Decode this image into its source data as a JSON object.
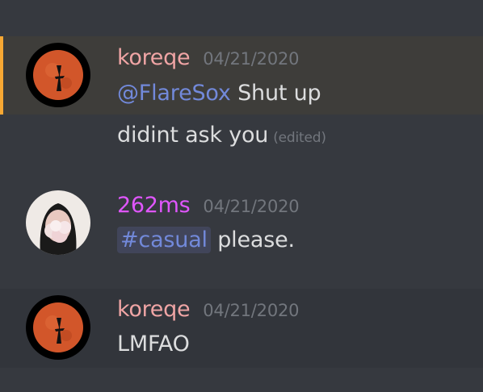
{
  "messages": [
    {
      "username": "koreqe",
      "username_color": "#f0a5a5",
      "timestamp": "04/21/2020",
      "mention": "@FlareSox",
      "text": "Shut up",
      "followup": "didint ask you",
      "edited": "(edited)"
    },
    {
      "username": "262ms",
      "username_color": "#e056fd",
      "timestamp": "04/21/2020",
      "channel": "#casual",
      "text": "please."
    },
    {
      "username": "koreqe",
      "username_color": "#f0a5a5",
      "timestamp": "04/21/2020",
      "text": "LMFAO"
    }
  ],
  "icons": [
    "moon-avatar-icon",
    "profile-photo-avatar"
  ],
  "colors": {
    "background": "#36393f",
    "mention_highlight": "#3e3d3a",
    "mention_bar": "#f7a833",
    "link": "#7289da"
  }
}
